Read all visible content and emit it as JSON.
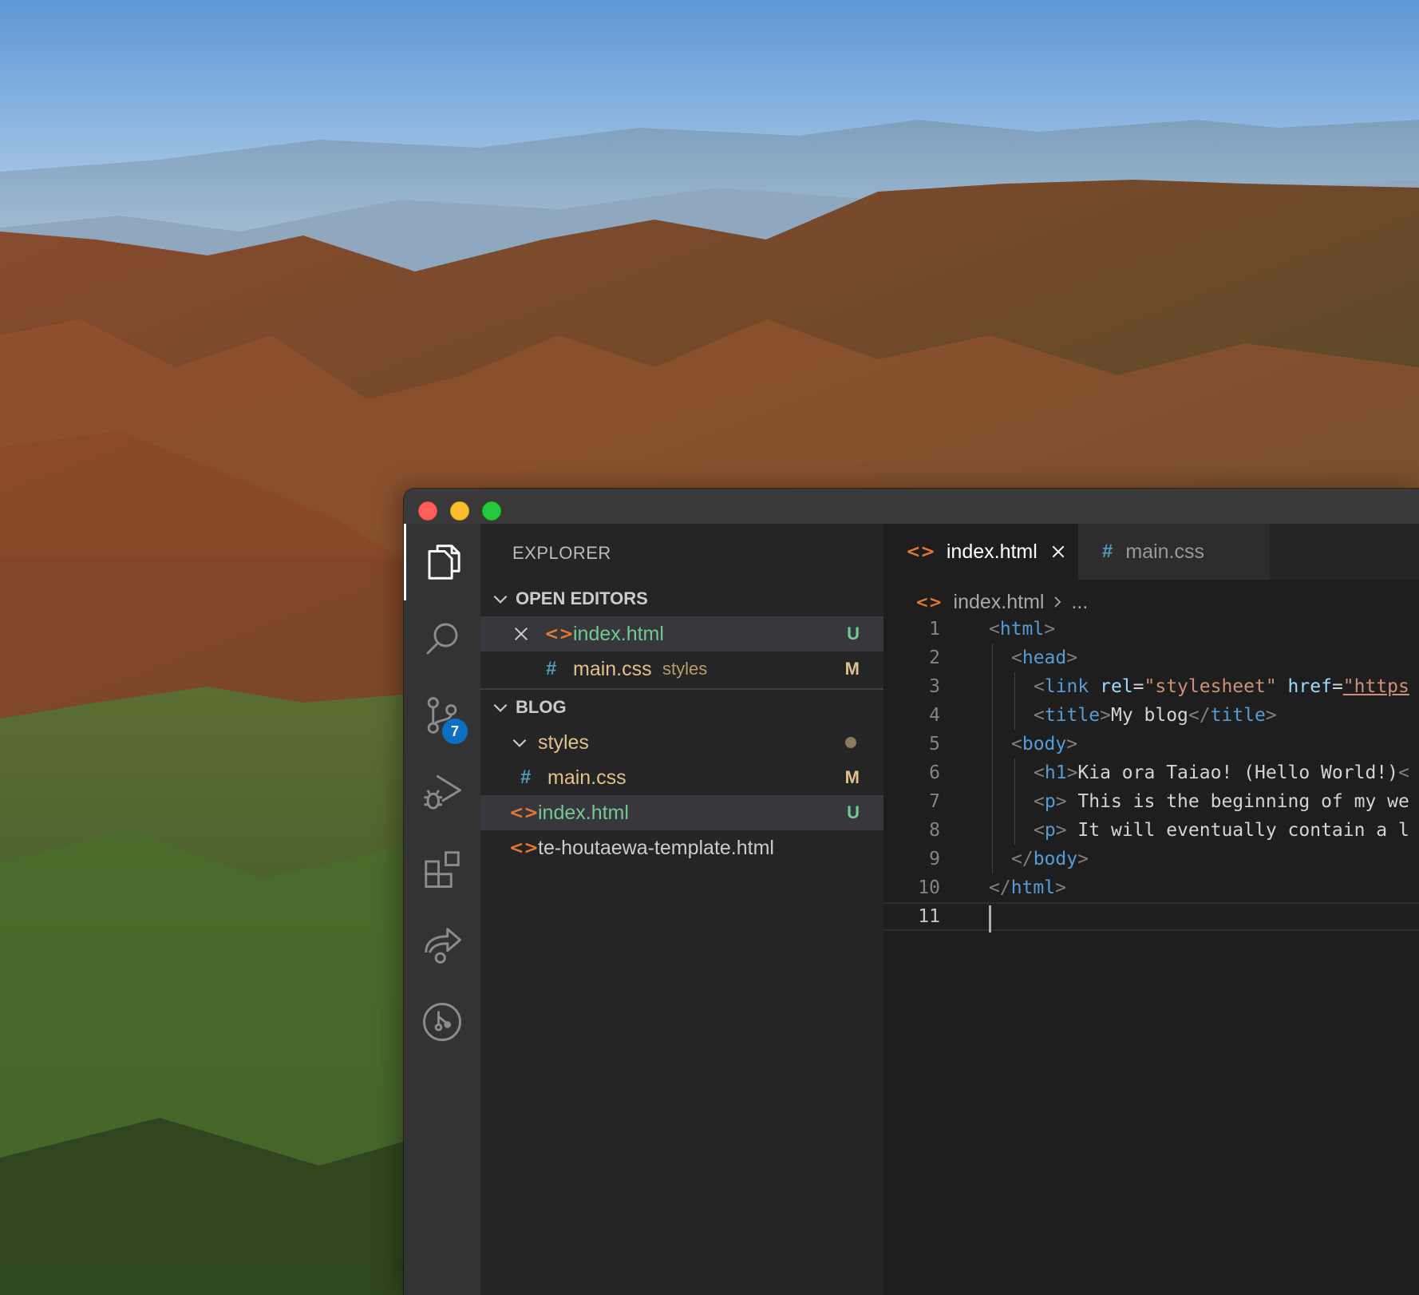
{
  "window": {
    "traffic_lights": {
      "close": "#fe5f57",
      "minimize": "#febc2e",
      "zoom": "#28c840"
    }
  },
  "activity_bar": {
    "items": [
      {
        "icon": "files-icon",
        "active": true
      },
      {
        "icon": "search-icon"
      },
      {
        "icon": "source-control-icon",
        "badge": "7"
      },
      {
        "icon": "run-debug-icon"
      },
      {
        "icon": "extensions-icon"
      },
      {
        "icon": "live-share-icon"
      },
      {
        "icon": "git-graph-icon"
      }
    ]
  },
  "sidebar": {
    "title": "EXPLORER",
    "open_editors": {
      "label": "OPEN EDITORS",
      "items": [
        {
          "name": "index.html",
          "status": "U",
          "icon": "html-icon"
        },
        {
          "name": "main.css",
          "description": "styles",
          "status": "M",
          "icon": "css-icon"
        }
      ]
    },
    "blog": {
      "label": "BLOG",
      "folder": {
        "name": "styles"
      },
      "items": [
        {
          "name": "main.css",
          "status": "M",
          "icon": "css-icon"
        },
        {
          "name": "index.html",
          "status": "U",
          "icon": "html-icon"
        },
        {
          "name": "te-houtaewa-template.html",
          "icon": "html-icon"
        }
      ]
    }
  },
  "editor": {
    "tabs": [
      {
        "label": "index.html",
        "icon": "html-icon",
        "active": true
      },
      {
        "label": "main.css",
        "icon": "css-icon"
      }
    ],
    "breadcrumb": {
      "file": "index.html",
      "more": "..."
    },
    "line_numbers": [
      "1",
      "2",
      "3",
      "4",
      "5",
      "6",
      "7",
      "8",
      "9",
      "10",
      "11"
    ],
    "lines": {
      "l1": {
        "open": "<",
        "tag": "html",
        "close": ">"
      },
      "l2": {
        "open": "<",
        "tag": "head",
        "close": ">"
      },
      "l3": {
        "open": "<",
        "tag": "link",
        "attr1": "rel",
        "eq1": "=",
        "val1": "\"stylesheet\"",
        "attr2": "href",
        "eq2": "=",
        "val2": "\"https"
      },
      "l4": {
        "open": "<",
        "tag": "title",
        "close": ">",
        "text": "My blog",
        "open2": "</",
        "tag2": "title",
        "close2": ">"
      },
      "l5": {
        "open": "<",
        "tag": "body",
        "close": ">"
      },
      "l6": {
        "open": "<",
        "tag": "h1",
        "close": ">",
        "text": "Kia ora Taiao! (Hello World!)",
        "trail": "<"
      },
      "l7": {
        "open": "<",
        "tag": "p",
        "close": ">",
        "text": " This is the beginning of my we"
      },
      "l8": {
        "open": "<",
        "tag": "p",
        "close": ">",
        "text": " It will eventually contain a l"
      },
      "l9": {
        "open": "</",
        "tag": "body",
        "close": ">"
      },
      "l10": {
        "open": "</",
        "tag": "html",
        "close": ">"
      }
    }
  }
}
